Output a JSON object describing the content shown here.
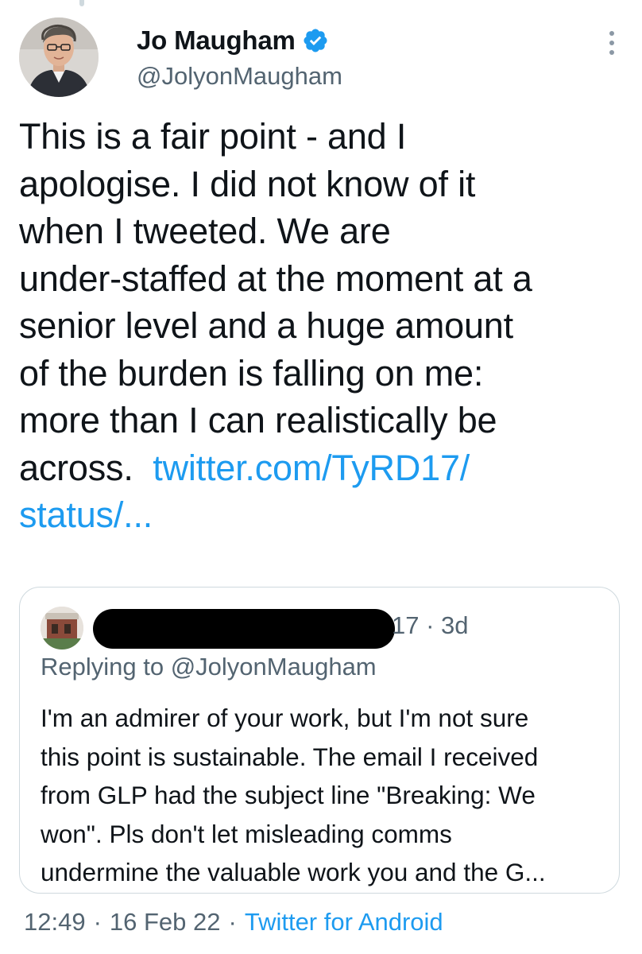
{
  "author": {
    "display_name": "Jo Maugham",
    "handle": "@JolyonMaugham",
    "verified": true
  },
  "tweet": {
    "text_lines": [
      "This is a fair point - and I",
      "apologise. I did not know of it",
      "when I tweeted. We are",
      "under-staffed at the moment at a",
      "senior level and a huge amount",
      "of the burden is falling on me:",
      "more than I can realistically be"
    ],
    "last_line_text": "across.",
    "link_line1": "twitter.com/TyRD17/",
    "link_line2": "status/..."
  },
  "quoted_tweet": {
    "meta_suffix": "17 · 3d",
    "replying_to": "Replying to @JolyonMaugham",
    "text_lines": [
      "I'm an admirer of your work, but I'm not sure",
      "this point is sustainable. The email I received",
      "from GLP had the subject line \"Breaking: We",
      "won\". Pls don't let misleading comms",
      "undermine the valuable work you and the G..."
    ]
  },
  "footer": {
    "time": "12:49",
    "date": "16 Feb 22",
    "source": "Twitter for Android",
    "separator": "·"
  },
  "colors": {
    "link": "#1d9bf0",
    "secondary_text": "#536471",
    "verified_badge": "#1d9bf0",
    "border": "#cfd9de"
  },
  "icons": {
    "verified": "verified-badge-icon",
    "more": "more-vertical-icon"
  }
}
